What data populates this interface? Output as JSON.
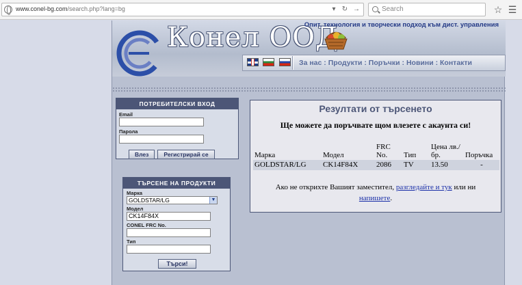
{
  "browser": {
    "url_host": "www.conel-bg.com",
    "url_path": "/search.php?lang=bg",
    "search_placeholder": "Search"
  },
  "header": {
    "brand": "Конел ООД",
    "tagline": "Опит, технология и творчески подход към дист. управления",
    "nav": {
      "about": "За нас",
      "products": "Продукти",
      "orders": "Поръчки",
      "news": "Новини",
      "contacts": "Контакти"
    }
  },
  "login": {
    "title": "ПОТРЕБИТЕЛСКИ ВХОД",
    "email_label": "Email",
    "email_value": "",
    "password_label": "Парола",
    "password_value": "",
    "login_button": "Влез",
    "register_button": "Регистрирай се"
  },
  "product_search": {
    "title": "ТЪРСЕНЕ НА ПРОДУКТИ",
    "brand_label": "Марка",
    "brand_value": "GOLDSTAR/LG",
    "model_label": "Модел",
    "model_value": "CK14F84X",
    "frc_label": "CONEL FRC No.",
    "frc_value": "",
    "type_label": "Тип",
    "type_value": "",
    "search_button": "Търси!"
  },
  "results": {
    "title": "Резултати от търсенето",
    "note": "Ще можете да поръчвате щом влезете с акаунта си!",
    "columns": [
      "Марка",
      "Модел",
      "FRC No.",
      "Тип",
      "Цена лв./бр.",
      "Поръчка"
    ],
    "rows": [
      {
        "brand": "GOLDSTAR/LG",
        "model": "CK14F84X",
        "frc": "2086",
        "type": "TV",
        "price": "13.50",
        "order": "-"
      }
    ],
    "footer_prefix": "Ако не откриxте Вашият заместител,",
    "footer_link1": "разгледайте и тук",
    "footer_mid": "или ни",
    "footer_link2": "напишете"
  },
  "colors": {
    "accent": "#4c5677",
    "page_bg": "#b9c0d1",
    "link": "#1a2fa8",
    "tagline": "#243a86"
  }
}
